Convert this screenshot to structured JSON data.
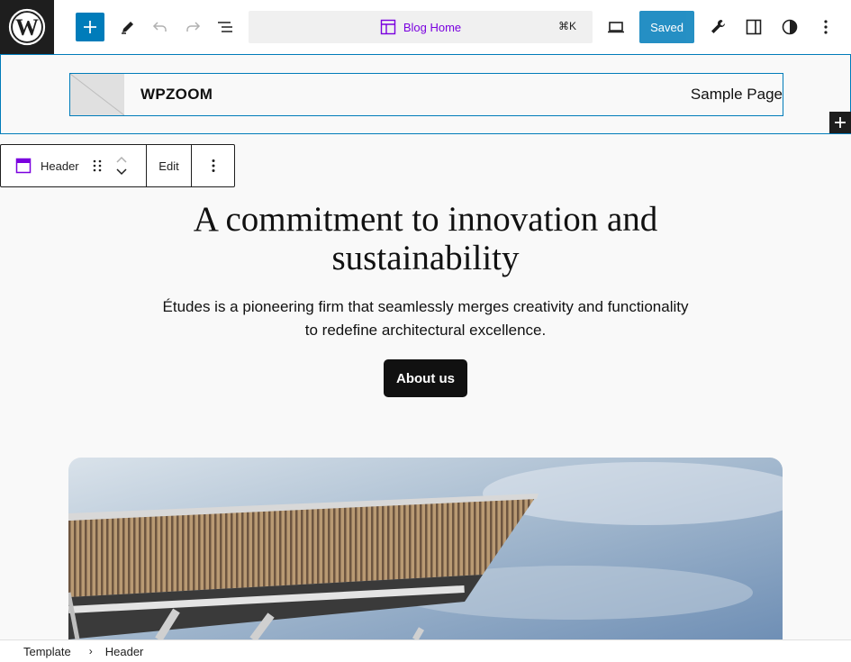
{
  "toolbar": {
    "command_title": "Blog Home",
    "command_shortcut": "⌘K",
    "saved_label": "Saved"
  },
  "site_header": {
    "site_title": "WPZOOM",
    "nav_items": [
      "Sample Page"
    ]
  },
  "block_toolbar": {
    "block_name": "Header",
    "edit_label": "Edit"
  },
  "hero": {
    "title": "A commitment to innovation and sustainability",
    "description": "Études is a pioneering firm that seamlessly merges creativity and functionality to redefine architectural excellence.",
    "button_label": "About us"
  },
  "breadcrumb": {
    "items": [
      "Template",
      "Header"
    ]
  },
  "colors": {
    "accent": "#007cba",
    "brand_purple": "#7a00df",
    "dark": "#1e1e1e"
  }
}
